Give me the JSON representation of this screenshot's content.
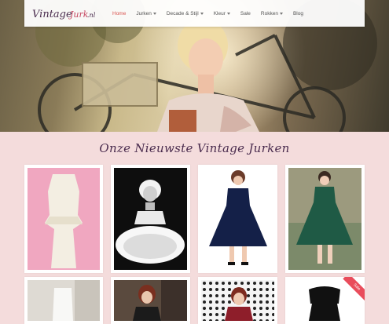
{
  "header": {
    "logo_text": "VintageJurk.nl",
    "nav": [
      {
        "label": "Home",
        "active": true,
        "dropdown": false
      },
      {
        "label": "Jurken",
        "active": false,
        "dropdown": true
      },
      {
        "label": "Decade & Stijl",
        "active": false,
        "dropdown": true
      },
      {
        "label": "Kleur",
        "active": false,
        "dropdown": true
      },
      {
        "label": "Sale",
        "active": false,
        "dropdown": false
      },
      {
        "label": "Rokken",
        "active": false,
        "dropdown": true
      },
      {
        "label": "Blog",
        "active": false,
        "dropdown": false
      }
    ]
  },
  "hero": {
    "alt_image": "woman-with-bicycle-photo"
  },
  "section": {
    "title": "Onze Nieuwste Vintage Jurken"
  },
  "products": [
    {
      "name": "cream-peplum-dress"
    },
    {
      "name": "marilyn-tulle-dress-photo"
    },
    {
      "name": "navy-swing-dress"
    },
    {
      "name": "green-swing-dress"
    },
    {
      "name": "white-dress-bedroom"
    },
    {
      "name": "red-haired-model-dress"
    },
    {
      "name": "polka-dot-backdrop-dress"
    },
    {
      "name": "black-top-sale-dress",
      "badge": "Sale"
    }
  ],
  "colors": {
    "accent": "#d9534f",
    "title": "#4a2c4e",
    "background": "#f4dcdc"
  }
}
